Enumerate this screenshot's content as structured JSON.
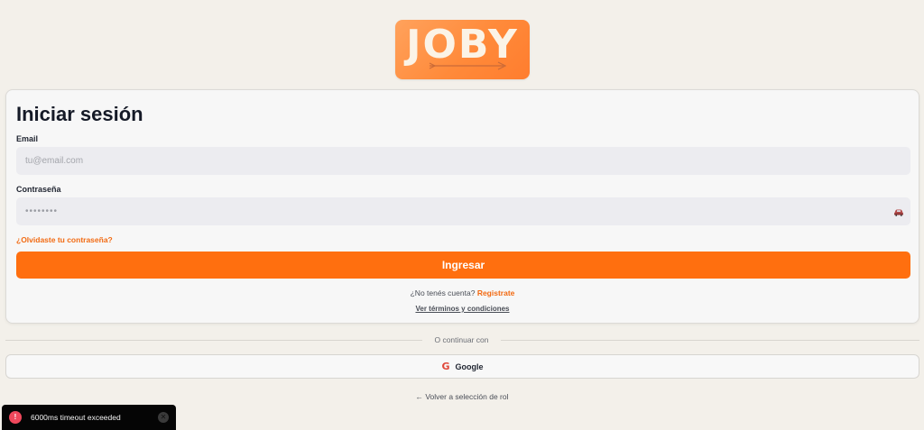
{
  "logo": {
    "text": "JOBY"
  },
  "login": {
    "title": "Iniciar sesión",
    "email_label": "Email",
    "email_placeholder": "tu@email.com",
    "password_label": "Contraseña",
    "password_value": "••••••••",
    "forgot_password": "¿Olvidaste tu contraseña?",
    "submit_label": "Ingresar",
    "signup_prompt": "¿No tenés cuenta?",
    "signup_link": "Registrate",
    "terms_link": "Ver términos y condiciones"
  },
  "divider": {
    "text": "O continuar con"
  },
  "google": {
    "icon_glyph": "G",
    "label": "Google"
  },
  "back_link": "← Volver a selección de rol",
  "toast": {
    "icon_glyph": "!",
    "message": "6000ms timeout exceeded",
    "close_glyph": "✕"
  },
  "colors": {
    "brand_orange": "#ff6f0f",
    "link_orange": "#f26a12",
    "background": "#f3f0ea",
    "error_red": "#f0485c"
  }
}
